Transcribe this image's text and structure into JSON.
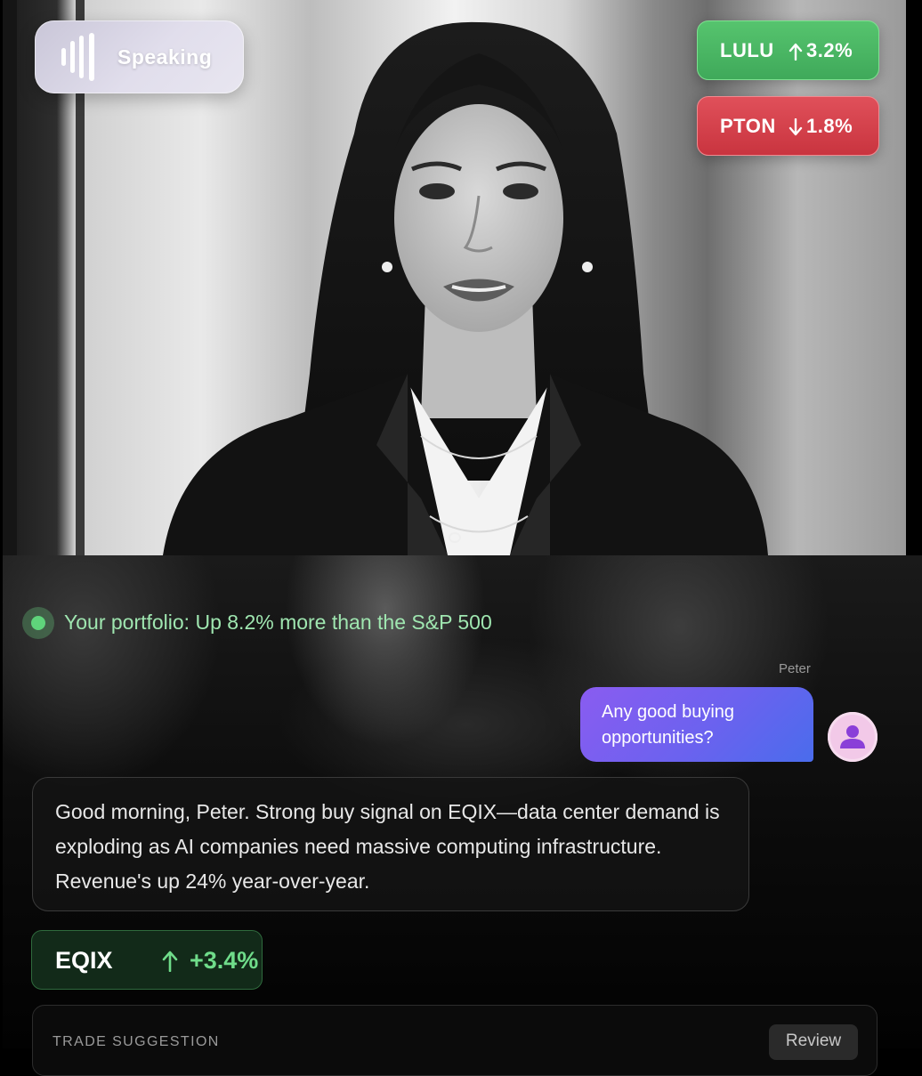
{
  "status": {
    "speaking_label": "Speaking"
  },
  "tickers": [
    {
      "symbol": "LULU",
      "change": "3.2%",
      "direction": "up",
      "color": "#4db865"
    },
    {
      "symbol": "PTON",
      "change": "1.8%",
      "direction": "down",
      "color": "#d8414b"
    }
  ],
  "portfolio": {
    "text": "Your portfolio: Up 8.2% more than the S&P 500"
  },
  "chat": {
    "user": {
      "name": "Peter",
      "message": "Any good buying opportunities?"
    },
    "assistant": {
      "message": "Good morning, Peter. Strong buy signal on EQIX—data center demand is exploding as AI companies need massive computing infrastructure. Revenue's up 24% year-over-year."
    }
  },
  "stock_chip": {
    "symbol": "EQIX",
    "change": "+3.4%",
    "direction": "up",
    "color": "#6fdc8a"
  },
  "trade_card": {
    "title": "TRADE SUGGESTION",
    "review_label": "Review"
  }
}
